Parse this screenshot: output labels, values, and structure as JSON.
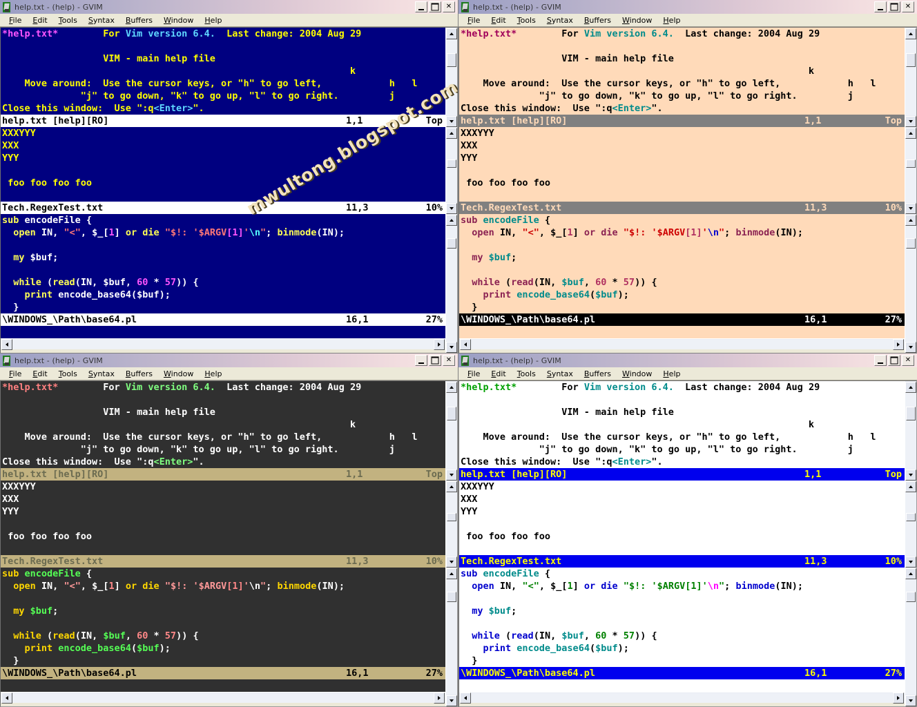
{
  "window": {
    "title": "help.txt - (help) - GVIM",
    "icon": "vim-gvim-icon",
    "buttons": {
      "minimize": "_",
      "maximize": "□",
      "close": "✕"
    },
    "menu": [
      {
        "label": "File",
        "accel": "F"
      },
      {
        "label": "Edit",
        "accel": "E"
      },
      {
        "label": "Tools",
        "accel": "T"
      },
      {
        "label": "Syntax",
        "accel": "S"
      },
      {
        "label": "Buffers",
        "accel": "B"
      },
      {
        "label": "Window",
        "accel": "W"
      },
      {
        "label": "Help",
        "accel": "H"
      }
    ]
  },
  "watermark": "mwultong.blogspot.com",
  "help_text": {
    "tag": "*help.txt*",
    "for": "For ",
    "version": "Vim version 6.4.",
    "lastchange": "  Last change: 2004 Aug 29",
    "heading": "VIM - main help file",
    "key_k": "k",
    "move_label": "    Move around:  ",
    "move_line1": "Use the cursor keys, or \"h\" to go left,",
    "key_h": "h",
    "key_l": "l",
    "move_line2": "              \"j\" to go down, \"k\" to go up, \"l\" to go right.",
    "key_j": "j",
    "close_label": "Close this window:  Use \":q",
    "close_enter": "<Enter>",
    "close_tail": "\"."
  },
  "buffer_text": {
    "line1": "XXXYYY",
    "line2": "XXX",
    "line3": "YYY",
    "line4": "",
    "line5": " foo foo foo foo"
  },
  "code": {
    "l1_kw": "sub",
    "l1_fn": " encodeFile",
    "l1_rest": " {",
    "l2_open": "  open",
    "l2_in": " IN",
    "l2_c1": ", ",
    "l2_str1": "\"<\"",
    "l2_c2": ", ",
    "l2_var": "$_",
    "l2_br1": "[",
    "l2_num1": "1",
    "l2_br2": "]",
    "l2_or": " or ",
    "l2_die": "die",
    "l2_s2a": " \"$!",
    "l2_s2b": ": '$ARGV",
    "l2_s2c": "[1]",
    "l2_s2d": "'",
    "l2_esc": "\\n",
    "l2_s2e": "\"",
    "l2_tail1": "; ",
    "l2_bin": "binmode",
    "l2_tail2": "(IN);",
    "l4_my": "  my",
    "l4_buf": " $buf",
    "l4_semi": ";",
    "l6_while": "  while",
    "l6_a": " (",
    "l6_read": "read",
    "l6_b": "(",
    "l6_in": "IN",
    "l6_c": ", ",
    "l6_buf": "$buf",
    "l6_d": ", ",
    "l6_n1": "60",
    "l6_e": " * ",
    "l6_n2": "57",
    "l6_f": ")) {",
    "l7_print": "    print",
    "l7_fn": " encode_base64",
    "l7_a": "(",
    "l7_buf": "$buf",
    "l7_b": ");",
    "l8": "  }"
  },
  "statuslines": {
    "help": {
      "file": "help.txt [help][RO]",
      "pos": "1,1",
      "pct": "Top"
    },
    "regex": {
      "file": "Tech.RegexTest.txt",
      "pos": "11,3",
      "pct": "10%"
    },
    "perl": {
      "file": "\\WINDOWS_\\Path\\base64.pl",
      "pos": "16,1",
      "pct": "27%"
    }
  },
  "panels": [
    {
      "id": "panel-top-left",
      "scheme": "blue",
      "colors": {
        "bg": "#000080",
        "fg": "#ffff00",
        "tag": "#ff55ff",
        "special": "#ffff55",
        "keyword": "#5fd7ff",
        "status_bg": "#ffffff",
        "status_fg": "#000000",
        "status_inactive_bg": "#ffffff",
        "status_inactive_fg": "#000000",
        "code_kw": "#ffff55",
        "code_fn": "#ffff55",
        "code_str": "#ff7777",
        "code_num": "#ff55ff",
        "code_var": "#ffffff",
        "code_esc": "#55ffff",
        "code_cond": "#ffffff",
        "code_fg": "#ffffff",
        "code_op": "#ffff55"
      },
      "watermark": true
    },
    {
      "id": "panel-top-right",
      "scheme": "peachpuff",
      "colors": {
        "bg": "#ffdab9",
        "fg": "#000000",
        "tag": "#a0005a",
        "special": "#000000",
        "keyword": "#008b8b",
        "status_bg": "#000000",
        "status_fg": "#ffffff",
        "status_inactive_bg": "#808080",
        "status_inactive_fg": "#ffdab9",
        "code_kw": "#8b2252",
        "code_fn": "#000000",
        "code_str": "#cd0000",
        "code_num": "#b03060",
        "code_var": "#008b8b",
        "code_esc": "#0000cd",
        "code_cond": "#000000",
        "code_fg": "#000000",
        "code_op": "#8b2252"
      },
      "watermark": false
    },
    {
      "id": "panel-bottom-left",
      "scheme": "darkgrey",
      "colors": {
        "bg": "#303030",
        "fg": "#ffffff",
        "tag": "#ff8080",
        "special": "#ffffff",
        "keyword": "#80ff80",
        "status_bg": "#c2b280",
        "status_fg": "#000000",
        "status_inactive_bg": "#c2b280",
        "status_inactive_fg": "#6b6b50",
        "code_kw": "#ffd700",
        "code_fn": "#ffffff",
        "code_str": "#ff9999",
        "code_num": "#ff8888",
        "code_var": "#55ff55",
        "code_esc": "#ffffff",
        "code_cond": "#ffffff",
        "code_fg": "#ffffff",
        "code_op": "#ffd700"
      },
      "watermark": false
    },
    {
      "id": "panel-bottom-right",
      "scheme": "white",
      "colors": {
        "bg": "#ffffff",
        "fg": "#000000",
        "tag": "#00a000",
        "special": "#000000",
        "keyword": "#008b8b",
        "status_bg": "#0000ee",
        "status_fg": "#ffff00",
        "status_inactive_bg": "#0000ee",
        "status_inactive_fg": "#ffff00",
        "code_kw": "#0000cd",
        "code_fn": "#000000",
        "code_str": "#008000",
        "code_num": "#008000",
        "code_var": "#008b8b",
        "code_esc": "#ff00ff",
        "code_cond": "#000000",
        "code_fg": "#000000",
        "code_op": "#0000cd"
      },
      "watermark": false
    }
  ]
}
